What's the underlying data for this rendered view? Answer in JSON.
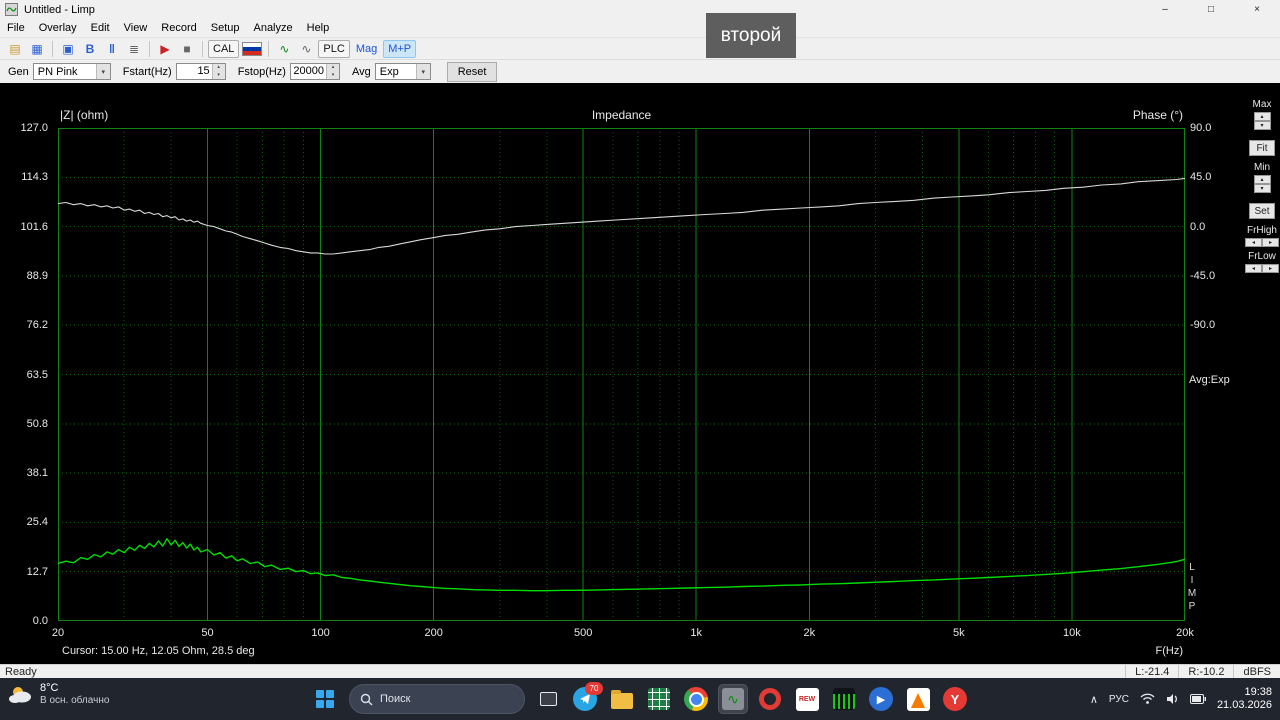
{
  "window": {
    "title": "Untitled - Limp",
    "controls": {
      "minimize": "–",
      "maximize": "□",
      "close": "×"
    }
  },
  "menu": {
    "items": [
      "File",
      "Overlay",
      "Edit",
      "View",
      "Record",
      "Setup",
      "Analyze",
      "Help"
    ]
  },
  "toolbar": {
    "icons": {
      "open": "▤",
      "save": "▦",
      "copy": "▣",
      "edit": "B",
      "pause": "‖",
      "table": "≣",
      "record": "▶",
      "stop": "■",
      "fr": "∿",
      "sine": "∿"
    },
    "cal": "CAL",
    "plc": "PLC",
    "mag": "Mag",
    "mp": "M+P"
  },
  "controls": {
    "gen_label": "Gen",
    "gen_value": "PN Pink",
    "fstart_label": "Fstart(Hz)",
    "fstart_value": "15",
    "fstop_label": "Fstop(Hz)",
    "fstop_value": "20000",
    "avg_label": "Avg",
    "avg_value": "Exp",
    "reset": "Reset",
    "spin_up": "▴",
    "spin_down": "▾",
    "combo_arrow": "▾"
  },
  "side_panel": {
    "max": "Max",
    "fit": "Fit",
    "min": "Min",
    "set": "Set",
    "frhigh": "FrHigh",
    "frlow": "FrLow",
    "up": "▴",
    "down": "▾",
    "left": "◂",
    "right": "▸",
    "avg_readout": "Avg:Exp",
    "watermark": [
      "L",
      "I",
      "M",
      "P"
    ]
  },
  "chart_data": {
    "type": "line",
    "title": "Impedance",
    "ylabel_left": "|Z| (ohm)",
    "ylabel_right": "Phase (°)",
    "xlabel": "F(Hz)",
    "x_scale": "log",
    "xlim": [
      20,
      20000
    ],
    "ylim_left": [
      0,
      127
    ],
    "phase_deg_per_div": 45,
    "yticks_left": [
      127.0,
      114.3,
      101.6,
      88.9,
      76.2,
      63.5,
      50.8,
      38.1,
      25.4,
      12.7,
      0.0
    ],
    "yticks_right": [
      90.0,
      45.0,
      0.0,
      -45.0,
      -90.0
    ],
    "xticks": [
      {
        "value": 20,
        "label": "20"
      },
      {
        "value": 50,
        "label": "50"
      },
      {
        "value": 100,
        "label": "100"
      },
      {
        "value": 200,
        "label": "200"
      },
      {
        "value": 500,
        "label": "500"
      },
      {
        "value": 1000,
        "label": "1k"
      },
      {
        "value": 2000,
        "label": "2k"
      },
      {
        "value": 5000,
        "label": "5k"
      },
      {
        "value": 10000,
        "label": "10k"
      },
      {
        "value": 20000,
        "label": "20k"
      }
    ],
    "grid": true,
    "legend": "none",
    "cursor_text": "Cursor: 15.00 Hz, 12.05 Ohm, 28.5 deg",
    "series": [
      {
        "name": "impedance-magnitude",
        "axis": "left",
        "color": "#00dd00",
        "width": 1.4,
        "points": [
          [
            20,
            14.8
          ],
          [
            21,
            15.4
          ],
          [
            22,
            15.0
          ],
          [
            23,
            16.3
          ],
          [
            24,
            15.9
          ],
          [
            25,
            17.1
          ],
          [
            26,
            16.5
          ],
          [
            27,
            17.8
          ],
          [
            28,
            17.2
          ],
          [
            29,
            18.4
          ],
          [
            30,
            17.6
          ],
          [
            31,
            19.0
          ],
          [
            32,
            18.2
          ],
          [
            33,
            19.5
          ],
          [
            34,
            18.7
          ],
          [
            35,
            20.0
          ],
          [
            36,
            19.1
          ],
          [
            37,
            20.6
          ],
          [
            38,
            19.3
          ],
          [
            39,
            21.2
          ],
          [
            40,
            19.6
          ],
          [
            41,
            20.8
          ],
          [
            42,
            19.2
          ],
          [
            43,
            20.2
          ],
          [
            44,
            18.8
          ],
          [
            45,
            19.8
          ],
          [
            46,
            18.3
          ],
          [
            47,
            19.0
          ],
          [
            48,
            17.8
          ],
          [
            50,
            18.4
          ],
          [
            52,
            17.0
          ],
          [
            54,
            17.6
          ],
          [
            56,
            16.2
          ],
          [
            58,
            16.8
          ],
          [
            60,
            15.5
          ],
          [
            62,
            16.0
          ],
          [
            65,
            14.8
          ],
          [
            68,
            15.2
          ],
          [
            71,
            14.0
          ],
          [
            74,
            14.4
          ],
          [
            78,
            13.3
          ],
          [
            82,
            13.6
          ],
          [
            86,
            12.7
          ],
          [
            90,
            13.0
          ],
          [
            94,
            12.2
          ],
          [
            98,
            12.4
          ],
          [
            103,
            11.7
          ],
          [
            108,
            11.9
          ],
          [
            114,
            11.2
          ],
          [
            120,
            11.0
          ],
          [
            127,
            10.6
          ],
          [
            135,
            10.3
          ],
          [
            143,
            10.0
          ],
          [
            152,
            9.7
          ],
          [
            162,
            9.4
          ],
          [
            173,
            9.1
          ],
          [
            185,
            8.9
          ],
          [
            200,
            8.6
          ],
          [
            215,
            8.4
          ],
          [
            232,
            8.3
          ],
          [
            252,
            8.1
          ],
          [
            275,
            8.0
          ],
          [
            300,
            7.9
          ],
          [
            330,
            7.9
          ],
          [
            365,
            7.8
          ],
          [
            400,
            7.8
          ],
          [
            445,
            7.9
          ],
          [
            495,
            7.9
          ],
          [
            550,
            8.0
          ],
          [
            610,
            8.1
          ],
          [
            680,
            8.2
          ],
          [
            760,
            8.3
          ],
          [
            850,
            8.4
          ],
          [
            950,
            8.5
          ],
          [
            1060,
            8.6
          ],
          [
            1190,
            8.7
          ],
          [
            1330,
            8.9
          ],
          [
            1500,
            9.0
          ],
          [
            1700,
            9.2
          ],
          [
            1900,
            9.3
          ],
          [
            2150,
            9.5
          ],
          [
            2400,
            9.6
          ],
          [
            2700,
            9.8
          ],
          [
            3000,
            10.0
          ],
          [
            3400,
            10.2
          ],
          [
            3800,
            10.4
          ],
          [
            4300,
            10.6
          ],
          [
            4800,
            10.8
          ],
          [
            5400,
            11.0
          ],
          [
            6000,
            11.2
          ],
          [
            6800,
            11.5
          ],
          [
            7600,
            11.7
          ],
          [
            8500,
            12.0
          ],
          [
            9500,
            12.3
          ],
          [
            10700,
            12.7
          ],
          [
            12000,
            13.1
          ],
          [
            13500,
            13.5
          ],
          [
            15000,
            14.0
          ],
          [
            17000,
            14.6
          ],
          [
            19000,
            15.3
          ],
          [
            20000,
            15.9
          ]
        ]
      },
      {
        "name": "phase",
        "axis": "right",
        "color": "#d8d8d8",
        "width": 1.1,
        "points": [
          [
            20,
            21
          ],
          [
            21,
            22
          ],
          [
            22,
            20
          ],
          [
            23,
            21
          ],
          [
            24,
            19
          ],
          [
            25,
            20
          ],
          [
            26,
            18
          ],
          [
            27,
            19
          ],
          [
            28,
            17
          ],
          [
            29,
            18
          ],
          [
            30,
            15
          ],
          [
            31,
            16
          ],
          [
            32,
            14
          ],
          [
            33,
            15
          ],
          [
            34,
            12
          ],
          [
            35,
            13
          ],
          [
            36,
            11
          ],
          [
            37,
            12
          ],
          [
            38,
            9
          ],
          [
            39,
            10
          ],
          [
            40,
            8
          ],
          [
            41,
            9
          ],
          [
            42,
            6
          ],
          [
            43,
            7
          ],
          [
            44,
            5
          ],
          [
            45,
            6
          ],
          [
            46,
            4
          ],
          [
            47,
            5
          ],
          [
            48,
            3
          ],
          [
            50,
            1
          ],
          [
            52,
            0
          ],
          [
            54,
            -2
          ],
          [
            56,
            -4
          ],
          [
            58,
            -5
          ],
          [
            60,
            -7
          ],
          [
            62,
            -9
          ],
          [
            65,
            -11
          ],
          [
            68,
            -13
          ],
          [
            71,
            -15
          ],
          [
            74,
            -17
          ],
          [
            78,
            -19
          ],
          [
            82,
            -20
          ],
          [
            86,
            -22
          ],
          [
            90,
            -23
          ],
          [
            94,
            -24
          ],
          [
            98,
            -24
          ],
          [
            103,
            -25
          ],
          [
            108,
            -25
          ],
          [
            114,
            -24
          ],
          [
            120,
            -23
          ],
          [
            127,
            -22
          ],
          [
            135,
            -21
          ],
          [
            143,
            -19
          ],
          [
            152,
            -18
          ],
          [
            162,
            -16
          ],
          [
            173,
            -14
          ],
          [
            185,
            -12
          ],
          [
            200,
            -10
          ],
          [
            215,
            -8
          ],
          [
            232,
            -7
          ],
          [
            252,
            -5
          ],
          [
            275,
            -3
          ],
          [
            300,
            -2
          ],
          [
            330,
            0
          ],
          [
            365,
            1
          ],
          [
            400,
            2
          ],
          [
            445,
            3
          ],
          [
            495,
            4
          ],
          [
            550,
            5
          ],
          [
            610,
            6
          ],
          [
            680,
            7
          ],
          [
            760,
            8
          ],
          [
            850,
            9
          ],
          [
            950,
            10
          ],
          [
            1060,
            11
          ],
          [
            1190,
            12
          ],
          [
            1330,
            13
          ],
          [
            1500,
            15
          ],
          [
            1700,
            16
          ],
          [
            1900,
            17
          ],
          [
            2150,
            18
          ],
          [
            2400,
            19
          ],
          [
            2700,
            21
          ],
          [
            3000,
            22
          ],
          [
            3400,
            23
          ],
          [
            3800,
            24
          ],
          [
            4300,
            26
          ],
          [
            4800,
            27
          ],
          [
            5400,
            28
          ],
          [
            6000,
            29
          ],
          [
            6800,
            31
          ],
          [
            7600,
            32
          ],
          [
            8500,
            33
          ],
          [
            9500,
            35
          ],
          [
            10700,
            36
          ],
          [
            12000,
            38
          ],
          [
            13500,
            39
          ],
          [
            15000,
            41
          ],
          [
            17000,
            42
          ],
          [
            19000,
            43
          ],
          [
            20000,
            44
          ]
        ]
      }
    ]
  },
  "overlay": {
    "text": "второй"
  },
  "status": {
    "ready": "Ready",
    "left_level": "L:-21.4",
    "right_level": "R:-10.2",
    "units": "dBFS"
  },
  "taskbar": {
    "weather": {
      "temp": "8°C",
      "desc": "В осн. облачно"
    },
    "search_placeholder": "Поиск",
    "telegram_badge": "70",
    "rew_label": "REW",
    "yandex_label": "Y",
    "media_play_glyph": "▶",
    "limp_glyph": "∿",
    "tray": {
      "expand": "∧",
      "lang": "РУС",
      "time": "19:38",
      "date": "21.03.2026"
    }
  }
}
